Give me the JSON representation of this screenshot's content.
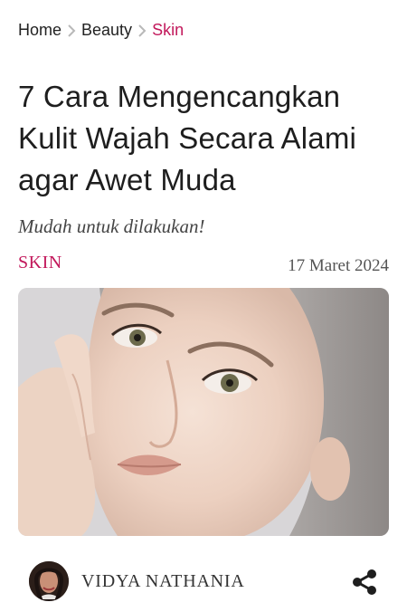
{
  "breadcrumb": {
    "items": [
      {
        "label": "Home",
        "active": false
      },
      {
        "label": "Beauty",
        "active": false
      },
      {
        "label": "Skin",
        "active": true
      }
    ],
    "separator_icon": "chevron-right-icon"
  },
  "article": {
    "title": "7 Cara Mengencangkan Kulit Wajah Secara Alami agar Awet Muda",
    "subtitle": "Mudah untuk dilakukan!",
    "category": "SKIN",
    "date": "17 Maret 2024",
    "hero_image": "woman-face-photo"
  },
  "author": {
    "name": "VIDYA NATHANIA",
    "avatar": "author-avatar-photo"
  },
  "actions": {
    "share_icon": "share-icon"
  },
  "colors": {
    "accent": "#c2185b",
    "text": "#222222",
    "muted": "#555555"
  }
}
